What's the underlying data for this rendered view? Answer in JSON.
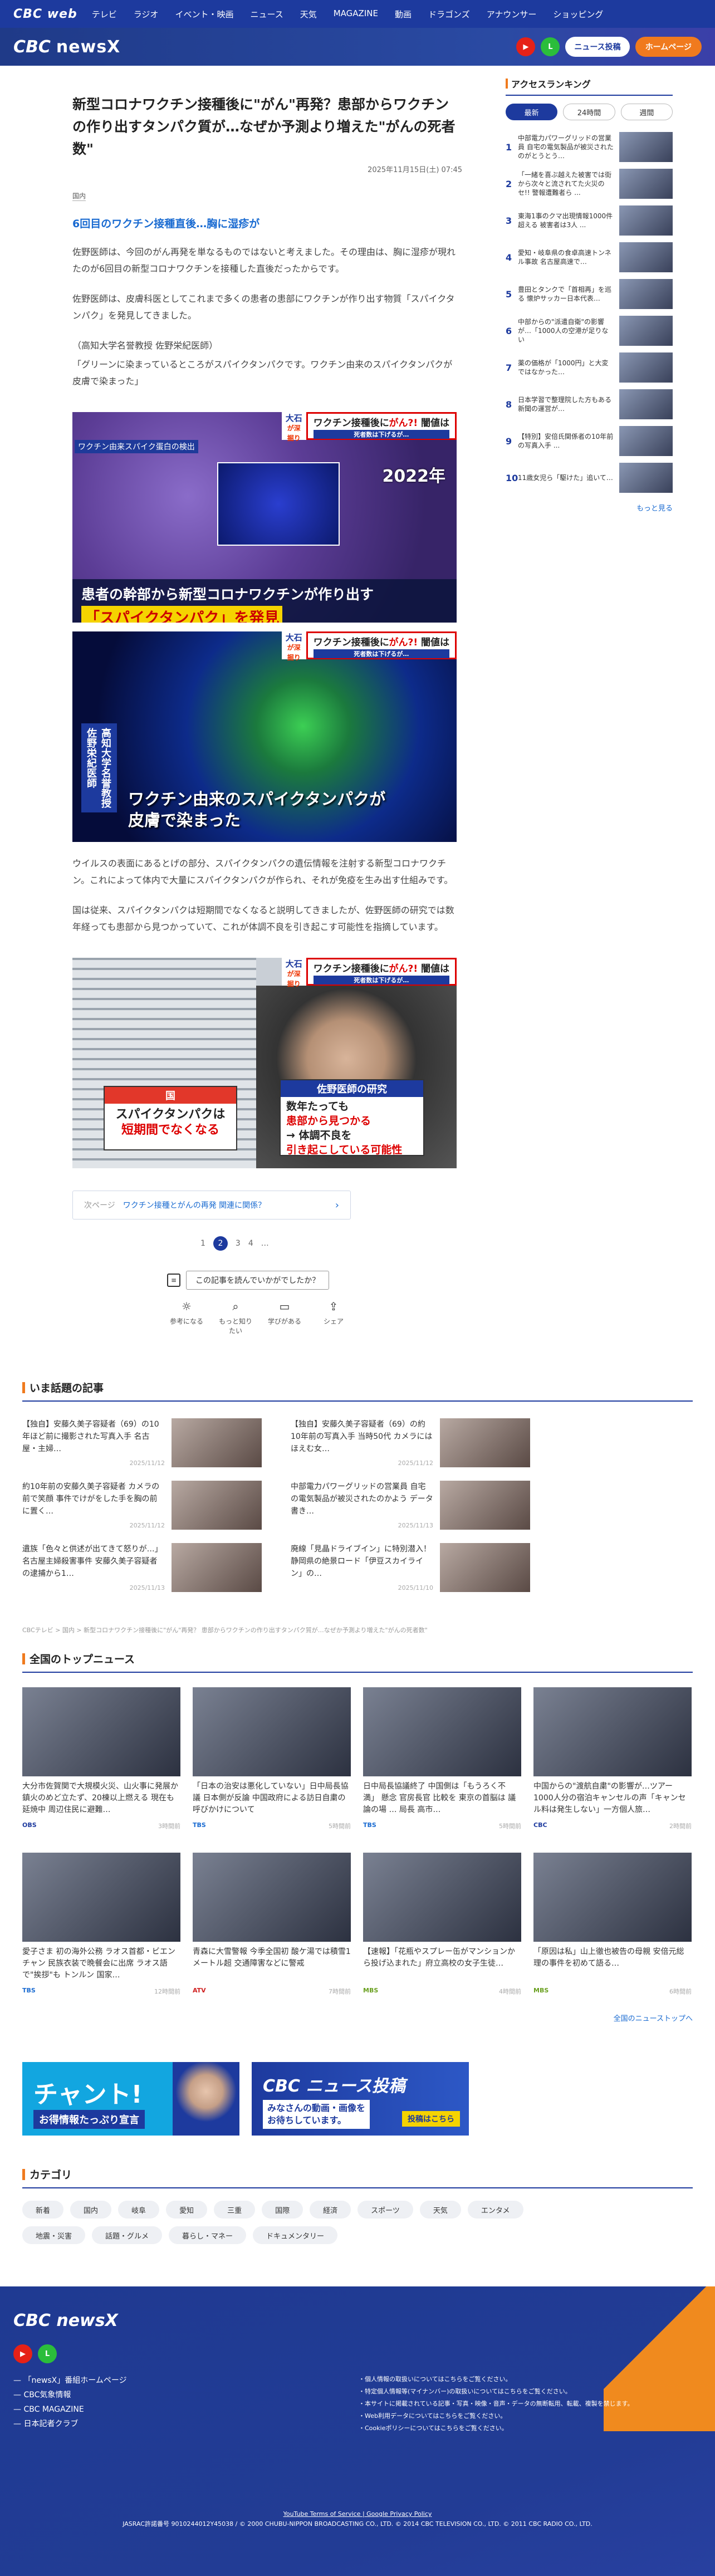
{
  "topnav": {
    "logo": "CBC web",
    "items": [
      "テレビ",
      "ラジオ",
      "イベント・映画",
      "ニュース",
      "天気",
      "MAGAZINE",
      "動画",
      "ドラゴンズ",
      "アナウンサー",
      "ショッピング"
    ]
  },
  "subhead": {
    "logo": "CBC",
    "brand": "newsX",
    "news_post": "ニュース投稿",
    "home": "ホームページ"
  },
  "article": {
    "title": "新型コロナワクチン接種後に\"がん\"再発？患部からワクチンの作り出すタンパク質が…なぜか予測より増えた\"がんの死者数\"",
    "date": "2025年11月15日(土) 07:45",
    "category": "国内",
    "lead": "6回目のワクチン接種直後…胸に湿疹が",
    "p1": "佐野医師は、今回のがん再発を単なるものではないと考えました。その理由は、胸に湿疹が現れたのが6回目の新型コロナワクチンを接種した直後だったからです。",
    "p2": "佐野医師は、皮膚科医としてこれまで多くの患者の患部にワクチンが作り出す物質「スパイクタンパク」を発見してきました。",
    "p3": "（高知大学名誉教授 佐野栄紀医師）",
    "p4": "「グリーンに染まっているところがスパイクタンパクです。ワクチン由来のスパイクタンパクが皮膚で染まった」",
    "img1": {
      "tl": "ワクチン由来スパイク蛋白の検出",
      "year": "2022年",
      "cap1": "患者の幹部から新型コロナワクチンが作り出す",
      "cap2": "「スパイクタンパク」を発見"
    },
    "banner": {
      "name": "大石",
      "sub": "が深掘り",
      "title1": "ワクチン接種後に",
      "title2": "がん?!",
      "title3": "闇値は",
      "sub2": "死者数は下げるが…"
    },
    "img2": {
      "vname": "高知大学名誉教授 佐野栄紀医師",
      "cap": "ワクチン由来のスパイクタンパクが\n皮膚で染まった"
    },
    "p5": "ウイルスの表面にあるとげの部分、スパイクタンパクの遺伝情報を注射する新型コロナワクチン。これによって体内で大量にスパイクタンパクが作られ、それが免疫を生み出す仕組みです。",
    "p6": "国は従来、スパイクタンパクは短期間でなくなると説明してきましたが、佐野医師の研究では数年経っても患部から見つかっていて、これが体調不良を引き起こす可能性を指摘しています。",
    "img3": {
      "box1h": "国",
      "box1t1": "スパイクタンパクは",
      "box1t2": "短期間でなくなる",
      "box2h": "佐野医師の研究",
      "box2t1": "数年たっても",
      "box2t2": "患部から見つかる",
      "box2t3": "→ 体調不良を",
      "box2t4": "引き起こしている可能性"
    },
    "next": {
      "label": "次ページ",
      "title": "ワクチン接種とがんの再発 関連に関係？"
    },
    "pages": [
      "1",
      "2",
      "3",
      "4",
      "…"
    ],
    "rate": {
      "q": "この記事を読んでいかがでしたか？",
      "acts": [
        "参考になる",
        "もっと知りたい",
        "学びがある",
        "シェア"
      ]
    }
  },
  "sidebar": {
    "title": "アクセスランキング",
    "tabs": [
      "最新",
      "24時間",
      "週間"
    ],
    "items": [
      "中部電力パワーグリッドの営業員 自宅の電気製品が被災されたのがとうとう…",
      "「一緒を喜ぶ越えた被害では街から次々と流されてた火災のセ!! 警報遭難者ら ...",
      "東海1事のクマ出現情報1000件 超える 被害者は3人 ...",
      "愛知・岐阜県の食卓高速トンネル事故 名古屋高速で…",
      "豊田とタンクで「首相再」を巡る 懐炉サッカー日本代表…",
      "中部からの\"派遣自衛\"の影響が…「1000人の空港が足りない",
      "薬の価格が「1000円」と大変ではなかった…",
      "日本学習で整理院した方もある 新聞の運営が…",
      "【特別】安倍氏関係者の10年前の写真入手 ...",
      "11歳女児ら「駆けた」追いて…"
    ],
    "more": "もっと見る"
  },
  "topics": {
    "title": "いま話題の記事",
    "items": [
      {
        "t": "【独自】安藤久美子容疑者（69）の10年ほど前に撮影された写真入手 名古屋・主婦…",
        "d": "2025/11/12"
      },
      {
        "t": "【独自】安藤久美子容疑者（69）の約10年前の写真入手 当時50代 カメラにはほえむ女…",
        "d": "2025/11/12"
      },
      {
        "t": "約10年前の安藤久美子容疑者 カメラの前で笑顔 事件でけがをした手を胸の前に置く…",
        "d": "2025/11/12"
      },
      {
        "t": "中部電力パワーグリッドの営業員 自宅の電気製品が被災されたのかよう データ書き…",
        "d": "2025/11/13"
      },
      {
        "t": "遺族「色々と供述が出てきて怒りが…」名古屋主婦殺害事件 安藤久美子容疑者の逮捕から1…",
        "d": "2025/11/13"
      },
      {
        "t": "廃線「見晶ドライブイン」に特別潜入！静岡県の絶景ロード「伊豆スカイライン」の…",
        "d": "2025/11/10"
      }
    ]
  },
  "crumbs": "CBCテレビ > 国内 > 新型コロナワクチン接種後に\"がん\"再発？ 患部からワクチンの作り出すタンパク質が…なぜか予測より増えた\"がんの死者数\"",
  "topnews": {
    "title": "全国のトップニュース",
    "items": [
      {
        "t": "大分市佐賀関で大規模火災、山火事に発展か 鎮火のめど立たず、20棟以上燃える 現在も延焼中 周辺住民に避難…",
        "src": "OBS",
        "dt": "3時間前"
      },
      {
        "t": "「日本の治安は悪化していない」日中局長協議 日本側が反論 中国政府による訪日自粛の呼びかけについて",
        "src": "TBS",
        "dt": "5時間前"
      },
      {
        "t": "日中局長協議終了 中国側は「もうろく不満」 懸念 官房長官 比較を 東京の首脳は 議論の場 … 局長 高市…",
        "src": "TBS",
        "dt": "5時間前"
      },
      {
        "t": "中国からの\"渡航自粛\"の影響が…ツアー1000人分の宿泊キャンセルの声「キャンセル料は発生しない」一方個人旅…",
        "src": "CBC",
        "dt": "2時間前"
      },
      {
        "t": "愛子さま 初の海外公務 ラオス首都・ビエンチャン 民族衣装で晩餐会に出席 ラオス語で\"挨拶\"も トンルン 国家…",
        "src": "TBS",
        "dt": "12時間前"
      },
      {
        "t": "青森に大雪警報 今季全国初 酸ケ湯では積雪1メートル超 交通障害などに警戒",
        "src": "ATV",
        "dt": "7時間前"
      },
      {
        "t": "【速報】「花瓶やスプレー缶がマンションから投げ込まれた」府立高校の女子生徒…",
        "src": "MBS",
        "dt": "4時間前"
      },
      {
        "t": "「原因は私」山上徹也被告の母親 安倍元総理の事件を初めて語る…",
        "src": "MBS",
        "dt": "6時間前"
      }
    ],
    "all": "全国のニューストップへ"
  },
  "ads": {
    "a1t1": "チャント!",
    "a1t2": "お得情報たっぷり宣言",
    "a2t1": "CBC ニュース投稿",
    "a2t2": "みなさんの動画・画像を\nお待ちしています。",
    "a2t3": "投稿はこちら"
  },
  "categories": {
    "title": "カテゴリ",
    "row1": [
      "新着",
      "国内",
      "岐阜",
      "愛知",
      "三重",
      "国際",
      "経済",
      "スポーツ",
      "天気",
      "エンタメ"
    ],
    "row2": [
      "地震・災害",
      "話題・グルメ",
      "暮らし・マネー",
      "ドキュメンタリー"
    ]
  },
  "footer": {
    "logo": "CBC newsX",
    "links": [
      "「newsX」番組ホームページ",
      "CBC気象情報",
      "CBC MAGAZINE",
      "日本記者クラブ"
    ],
    "right": [
      "個人情報の取扱いについてはこちらをご覧ください。",
      "特定個人情報等(マイナンバー)の取扱いについてはこちらをご覧ください。",
      "本サイトに掲載されている記事・写真・映像・音声・データの無断転用、転載、複製を禁じます。",
      "Web利用データについてはこちらをご覧ください。",
      "Cookieポリシーについてはこちらをご覧ください。"
    ],
    "bot1": "YouTube Terms of Service | Google Privacy Policy",
    "bot2": "JASRAC許諾番号 9010244012Y45038 / © 2000 CHUBU-NIPPON BROADCASTING CO., LTD. © 2014 CBC TELEVISION CO., LTD. © 2011 CBC RADIO CO., LTD."
  }
}
